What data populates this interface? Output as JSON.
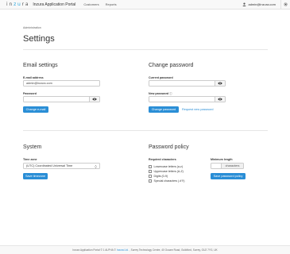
{
  "nav": {
    "logo_prefix": "in",
    "logo_accent": "zu",
    "logo_suffix": "ra",
    "app_title": "Inzura Application Portal",
    "links": [
      "Customers",
      "Reports"
    ],
    "user_email": "admin@inzura.com"
  },
  "breadcrumb": "Administration",
  "page_title": "Settings",
  "email": {
    "title": "Email settings",
    "email_label": "E-mail address",
    "email_value": "admin@inzura.com",
    "password_label": "Password",
    "button": "Change e-mail"
  },
  "password": {
    "title": "Change password",
    "current_label": "Current password",
    "new_label": "New password",
    "new_info_icon": "ⓘ",
    "button": "Change password",
    "request_link": "Request new password"
  },
  "system": {
    "title": "System",
    "timezone_label": "Time zone",
    "timezone_value": "(UTC) Coordinated Universal Time",
    "button": "Save timezone"
  },
  "policy": {
    "title": "Password policy",
    "required_label": "Required characters",
    "options": [
      "Lowercase letters (a-z)",
      "Uppercase letters (A-Z)",
      "Digits (0-9)",
      "Special characters (.#?!)"
    ],
    "min_length_label": "Minimum length",
    "unit": "characters",
    "button": "Save password policy"
  },
  "footer": {
    "text_before": "Inzura Application Portal © 1 ALPHA ©",
    "link": "Inzura Ltd.",
    "text_after": ", Surrey Technology Centre, 40 Occam Road, Guildford, Surrey, GU2 7YG, UK"
  },
  "colors": {
    "accent": "#2a8ed6",
    "logo_accent": "#29a6dd"
  }
}
